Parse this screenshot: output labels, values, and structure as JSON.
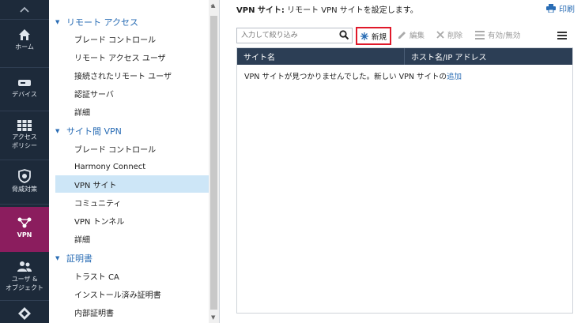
{
  "rail": {
    "items": [
      {
        "label": "ホーム",
        "icon": "home-icon"
      },
      {
        "label": "デバイス",
        "icon": "device-icon"
      },
      {
        "label": "アクセス\nポリシー",
        "icon": "access-policy-icon"
      },
      {
        "label": "脅威対策",
        "icon": "threat-prevention-icon"
      },
      {
        "label": "VPN",
        "icon": "vpn-icon"
      },
      {
        "label": "ユーザ &\nオブジェクト",
        "icon": "users-objects-icon"
      }
    ]
  },
  "tree": {
    "sections": [
      {
        "title": "リモート アクセス",
        "items": [
          "ブレード コントロール",
          "リモート アクセス ユーザ",
          "接続されたリモート ユーザ",
          "認証サーバ",
          "詳細"
        ]
      },
      {
        "title": "サイト間 VPN",
        "items": [
          "ブレード コントロール",
          "Harmony Connect",
          "VPN サイト",
          "コミュニティ",
          "VPN トンネル",
          "詳細"
        ]
      },
      {
        "title": "証明書",
        "items": [
          "トラスト CA",
          "インストール済み証明書",
          "内部証明書"
        ]
      }
    ],
    "selected": "VPN サイト"
  },
  "main": {
    "title_bold": "VPN サイト:",
    "title_rest": " リモート VPN サイトを設定します。",
    "print_label": "印刷",
    "search_placeholder": "入力して絞り込み",
    "toolbar": {
      "new_label": "新規",
      "edit_label": "編集",
      "delete_label": "削除",
      "toggle_label": "有効/無効"
    },
    "table": {
      "columns": [
        "サイト名",
        "ホスト名/IP アドレス"
      ],
      "empty_text": "VPN サイトが見つかりませんでした。新しい VPN サイトの",
      "empty_link": "追加"
    }
  },
  "colors": {
    "rail_bg": "#1d2a3a",
    "rail_active": "#8b1d5e",
    "accent_blue": "#2a6db5",
    "table_header": "#2c3e55",
    "highlight_red": "#e0192a",
    "selected_bg": "#cde6f7"
  }
}
